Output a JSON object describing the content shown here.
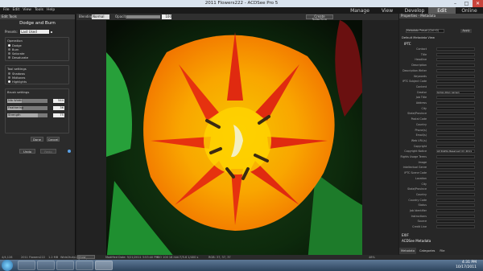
{
  "window": {
    "title": "2011 Flowers222 - ACDSee Pro 5",
    "minimize": "–",
    "maximize": "□",
    "close": "✕"
  },
  "menu": [
    "File",
    "Edit",
    "View",
    "Tools",
    "Help"
  ],
  "modes": [
    {
      "label": "Manage"
    },
    {
      "label": "View"
    },
    {
      "label": "Develop"
    },
    {
      "label": "Edit"
    },
    {
      "label": "Online"
    }
  ],
  "left": {
    "header": "Edit Tools",
    "title": "Dodge and Burn",
    "presets_label": "Presets:",
    "preset": "Last Used",
    "operation": {
      "heading": "Operation",
      "items": [
        "Dodge",
        "Burn",
        "Saturate",
        "Desaturate"
      ],
      "selected": 0
    },
    "tool": {
      "heading": "Tool settings",
      "items": [
        "Shadows",
        "Midtones",
        "Highlights"
      ],
      "selected": 2
    },
    "brush": {
      "heading": "Brush settings",
      "sliders": [
        {
          "label": "Nib Width",
          "value": "544",
          "level": 0.35
        },
        {
          "label": "Feathering",
          "value": "36",
          "level": 0.36
        },
        {
          "label": "Strength",
          "value": "75",
          "level": 0.75
        }
      ]
    },
    "done": "Done",
    "cancel": "Cancel",
    "undo": "Undo",
    "redo": "Redo"
  },
  "center": {
    "blending_label": "Blending:",
    "blending": "Normal",
    "opacity_label": "Opacity:",
    "opacity": "100",
    "create_selection": "Create Selection"
  },
  "right": {
    "header": "Properties - Metadata",
    "view": "Metadata Preset (Ctrl+0)",
    "apply": "Apply",
    "section": "Default Metadata View",
    "iptc": "IPTC",
    "fields": [
      {
        "label": "Contact",
        "value": ""
      },
      {
        "label": "Title",
        "value": ""
      },
      {
        "label": "Headline",
        "value": ""
      },
      {
        "label": "Description",
        "value": ""
      },
      {
        "label": "Description Writer",
        "value": ""
      },
      {
        "label": "Keywords",
        "value": ""
      },
      {
        "label": "IPTC Subject Code",
        "value": ""
      },
      {
        "label": "Content",
        "value": ""
      },
      {
        "label": "Creator",
        "value": "Jamie Allen Larsen"
      },
      {
        "label": "Job Title",
        "value": ""
      },
      {
        "label": "Address",
        "value": ""
      },
      {
        "label": "City",
        "value": ""
      },
      {
        "label": "State/Province",
        "value": ""
      },
      {
        "label": "Postal Code",
        "value": ""
      },
      {
        "label": "Country",
        "value": ""
      },
      {
        "label": "Phone(s)",
        "value": ""
      },
      {
        "label": "Email(s)",
        "value": ""
      },
      {
        "label": "Web URL(s)",
        "value": ""
      },
      {
        "label": "Copyright",
        "value": ""
      },
      {
        "label": "Copyright Notice",
        "value": "All Rights Reserved (C) 2011"
      },
      {
        "label": "Rights Usage Terms",
        "value": ""
      },
      {
        "label": "Image",
        "value": ""
      },
      {
        "label": "Intellectual Genre",
        "value": ""
      },
      {
        "label": "IPTC Scene Code",
        "value": ""
      },
      {
        "label": "Location",
        "value": ""
      },
      {
        "label": "City",
        "value": ""
      },
      {
        "label": "State/Province",
        "value": ""
      },
      {
        "label": "Country",
        "value": ""
      },
      {
        "label": "Country Code",
        "value": ""
      },
      {
        "label": "Status",
        "value": ""
      },
      {
        "label": "Job Identifier",
        "value": ""
      },
      {
        "label": "Instructions",
        "value": ""
      },
      {
        "label": "Source",
        "value": ""
      },
      {
        "label": "Credit Line",
        "value": ""
      }
    ],
    "exif": "EXIF",
    "acdsee": "ACDSee Metadata",
    "tabs": [
      "Metadata",
      "Categories",
      "File"
    ]
  },
  "status": {
    "index": "4/4,128",
    "folder": "2011 Flowers222",
    "size": "1.2 MB",
    "name": "Wide2tulip.jpeg",
    "modified": "Modified Date: 5/21/2011 3:53:40 PM",
    "exposure": "ISO 100  18 mm  F/5.6  1/400 s",
    "zoom": "48%",
    "color": "RGB: 37, 37, 37",
    "show_saved": "Show Saved"
  },
  "clock": {
    "time": "4:31 PM",
    "date": "10/17/2011"
  }
}
